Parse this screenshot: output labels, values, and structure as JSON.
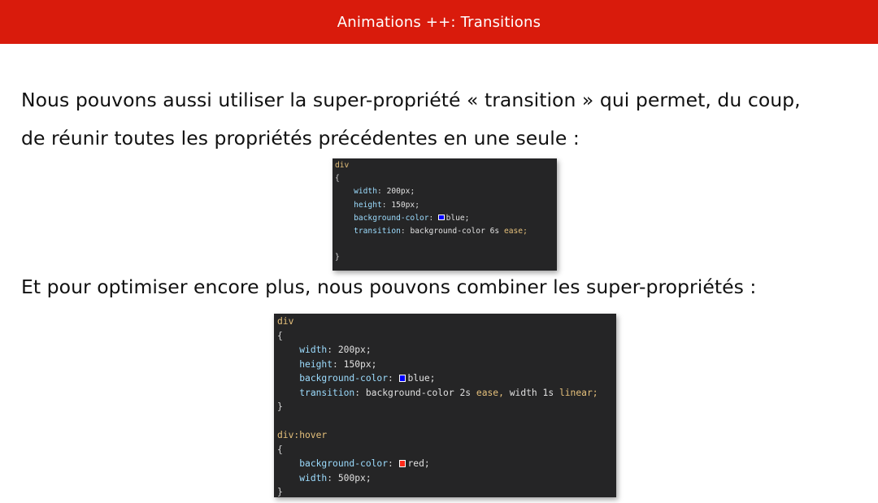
{
  "header": {
    "title": "Animations ++: Transitions",
    "background_color": "#d91b0c"
  },
  "content": {
    "paragraph_1_line_1": "Nous pouvons aussi utiliser la super-propriété « transition » qui permet, du coup,",
    "paragraph_1_line_2": "de réunir toutes les propriétés précédentes en une seule :",
    "paragraph_2": "Et pour optimiser encore plus, nous pouvons combiner les super-propriétés :"
  },
  "code_small": {
    "selector": "div",
    "open_brace": "{",
    "close_brace": "}",
    "width_prop": "width",
    "width_val": "200px;",
    "height_prop": "height",
    "height_val": "150px;",
    "bg_prop": "background-color",
    "bg_val": "blue;",
    "bg_swatch_color": "#0000ff",
    "transition_prop": "transition",
    "transition_val": "background-color 6s",
    "transition_kw": "ease;"
  },
  "code_large": {
    "selector": "div",
    "open_brace": "{",
    "close_brace": "}",
    "width_prop": "width",
    "width_val": "200px;",
    "height_prop": "height",
    "height_val": "150px;",
    "bg_prop": "background-color",
    "bg_val": "blue;",
    "bg_swatch_color": "#0000ff",
    "transition_prop": "transition",
    "transition_val_1": "background-color 2s",
    "transition_kw_1": "ease,",
    "transition_val_2": "width 1s",
    "transition_kw_2": "linear;",
    "hover_selector": "div:hover",
    "hover_open_brace": "{",
    "hover_close_brace": "}",
    "hover_bg_prop": "background-color",
    "hover_bg_val": "red;",
    "hover_swatch_color": "#ff2a1a",
    "hover_width_prop": "width",
    "hover_width_val": "500px;"
  }
}
